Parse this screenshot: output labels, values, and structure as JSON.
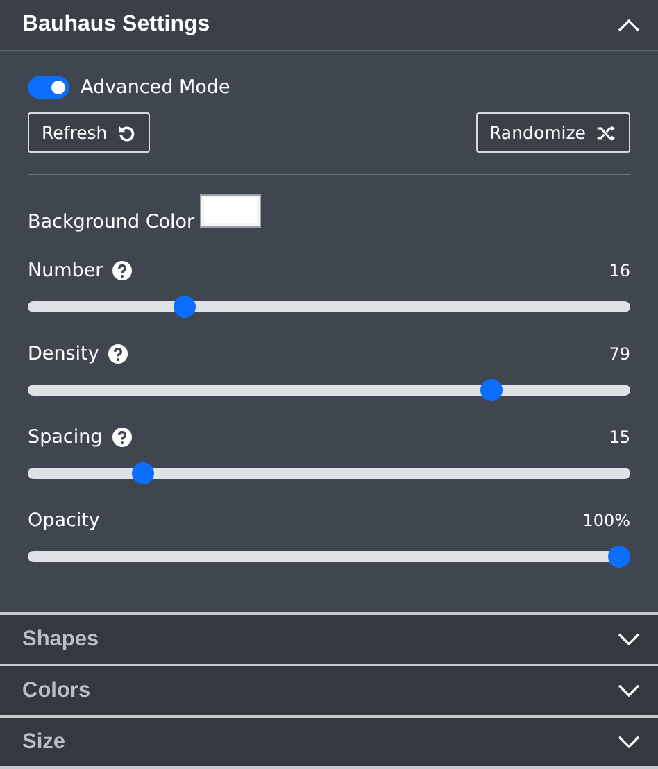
{
  "panel": {
    "title": "Bauhaus Settings",
    "expanded": true
  },
  "advanced_mode": {
    "label": "Advanced Mode",
    "on": true
  },
  "buttons": [
    {
      "label": "Refresh",
      "kind": "refresh"
    },
    {
      "label": "Randomize",
      "kind": "shuffle"
    }
  ],
  "background_color": {
    "label": "Background Color",
    "color": "#ffffff"
  },
  "sliders": [
    {
      "name": "Number",
      "help": true,
      "reading": "16",
      "level": 0.25
    },
    {
      "name": "Density",
      "help": true,
      "reading": "79",
      "level": 0.78
    },
    {
      "name": "Spacing",
      "help": true,
      "reading": "15",
      "level": 0.18
    },
    {
      "name": "Opacity",
      "help": false,
      "reading": "100%",
      "level": 1
    }
  ],
  "sections": [
    {
      "title": "Shapes",
      "expanded": false
    },
    {
      "title": "Colors",
      "expanded": false
    },
    {
      "title": "Size",
      "expanded": false
    }
  ]
}
